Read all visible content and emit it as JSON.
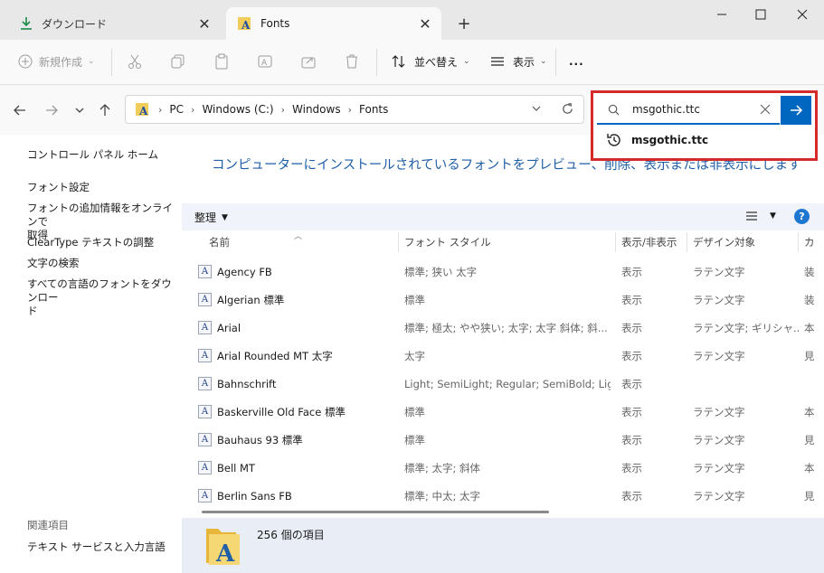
{
  "tabs": [
    {
      "label": "ダウンロード",
      "icon": "download-icon"
    },
    {
      "label": "Fonts",
      "icon": "fonts-folder-icon"
    }
  ],
  "toolbar": {
    "new_label": "新規作成",
    "sort_label": "並べ替え",
    "view_label": "表示",
    "more_label": "..."
  },
  "address": {
    "crumbs": [
      "PC",
      "Windows (C:)",
      "Windows",
      "Fonts"
    ]
  },
  "search": {
    "value": "msgothic.ttc",
    "suggestion": "msgothic.ttc"
  },
  "leftnav": {
    "home": "コントロール パネル ホーム",
    "font_settings": "フォント設定",
    "online_info_1": "フォントの追加情報をオンラインで",
    "online_info_2": "取得",
    "cleartype": "ClearType テキストの調整",
    "char_search": "文字の検索",
    "download_all_1": "すべての言語のフォントをダウンロー",
    "download_all_2": "ド",
    "related_header": "関連項目",
    "text_services": "テキスト サービスと入力言語"
  },
  "main": {
    "headline": "コンピューターにインストールされているフォントをプレビュー、削除、表示または非表示にします",
    "organize": "整理",
    "help": "?",
    "columns": [
      "名前",
      "フォント スタイル",
      "表示/非表示",
      "デザイン対象",
      "カ"
    ]
  },
  "fonts": [
    {
      "name": "Agency FB",
      "style": "標準; 狭い 太字",
      "show": "表示",
      "design": "ラテン文字",
      "cat": "装"
    },
    {
      "name": "Algerian 標準",
      "style": "標準",
      "show": "表示",
      "design": "ラテン文字",
      "cat": "装"
    },
    {
      "name": "Arial",
      "style": "標準; 極太; やや狭い; 太字; 太字 斜体; 斜...",
      "show": "表示",
      "design": "ラテン文字; ギリシャ...",
      "cat": "本"
    },
    {
      "name": "Arial Rounded MT 太字",
      "style": "太字",
      "show": "表示",
      "design": "ラテン文字",
      "cat": "見"
    },
    {
      "name": "Bahnschrift",
      "style": "Light; SemiLight; Regular; SemiBold; Ligh...",
      "show": "表示",
      "design": "",
      "cat": ""
    },
    {
      "name": "Baskerville Old Face 標準",
      "style": "標準",
      "show": "表示",
      "design": "ラテン文字",
      "cat": "本"
    },
    {
      "name": "Bauhaus 93 標準",
      "style": "標準",
      "show": "表示",
      "design": "ラテン文字",
      "cat": "見"
    },
    {
      "name": "Bell MT",
      "style": "標準; 太字; 斜体",
      "show": "表示",
      "design": "ラテン文字",
      "cat": "本"
    },
    {
      "name": "Berlin Sans FB",
      "style": "標準; 中太; 太字",
      "show": "表示",
      "design": "ラテン文字",
      "cat": "見"
    }
  ],
  "status": {
    "count": "256 個の項目"
  },
  "colors": {
    "accent": "#0067c0",
    "highlight_border": "#d42a2a",
    "headline": "#1f5fa8"
  }
}
